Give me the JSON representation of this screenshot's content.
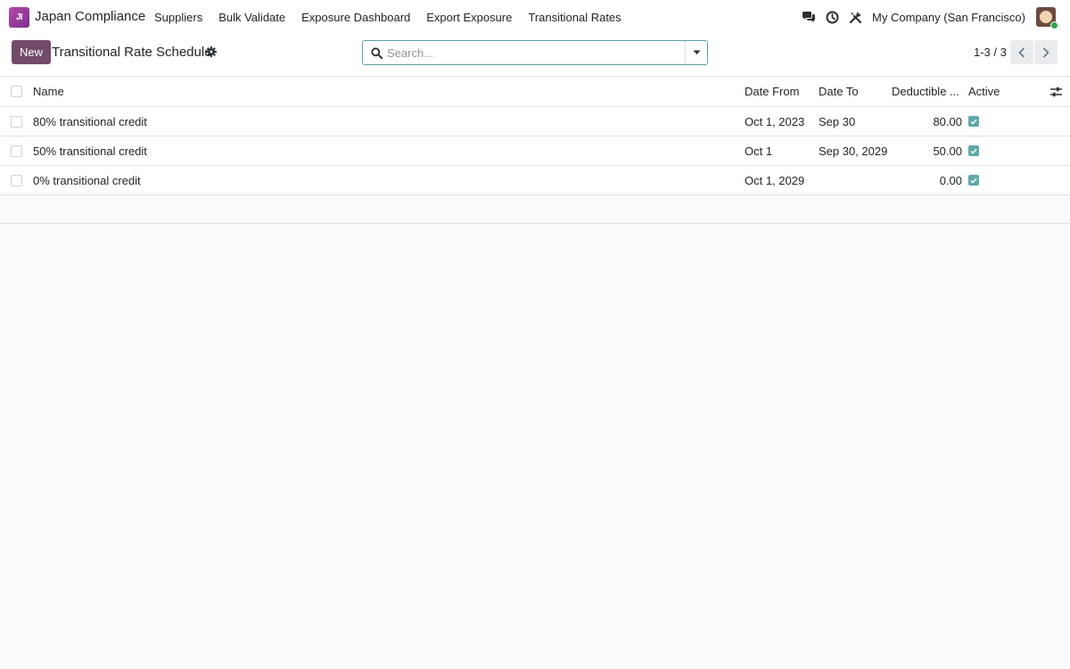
{
  "app": {
    "logo_text": "JI",
    "name": "Japan Compliance",
    "logo_color": "#a03d9a"
  },
  "nav": {
    "items": [
      {
        "label": "Suppliers"
      },
      {
        "label": "Bulk Validate"
      },
      {
        "label": "Exposure Dashboard"
      },
      {
        "label": "Export Exposure"
      },
      {
        "label": "Transitional Rates"
      }
    ]
  },
  "systray": {
    "icons": [
      "messages-icon",
      "activity-clock-icon",
      "debug-tools-icon"
    ],
    "company": "My Company (San Francisco)",
    "status_color": "#28a745"
  },
  "control": {
    "new_label": "New",
    "title": "Transitional Rate Schedule",
    "search_placeholder": "Search...",
    "pager": "1-3 / 3",
    "accent": "#714b67"
  },
  "table": {
    "headers": {
      "name": "Name",
      "date_from": "Date From",
      "date_to": "Date To",
      "deductible": "Deductible ...",
      "active": "Active"
    },
    "rows": [
      {
        "name": "80% transitional credit",
        "date_from": "Oct 1, 2023",
        "date_to": "Sep 30",
        "deductible": "80.00",
        "active": true
      },
      {
        "name": "50% transitional credit",
        "date_from": "Oct 1",
        "date_to": "Sep 30, 2029",
        "deductible": "50.00",
        "active": true
      },
      {
        "name": "0% transitional credit",
        "date_from": "Oct 1, 2029",
        "date_to": "",
        "deductible": "0.00",
        "active": true
      }
    ],
    "active_color": "#5fa8aa"
  }
}
